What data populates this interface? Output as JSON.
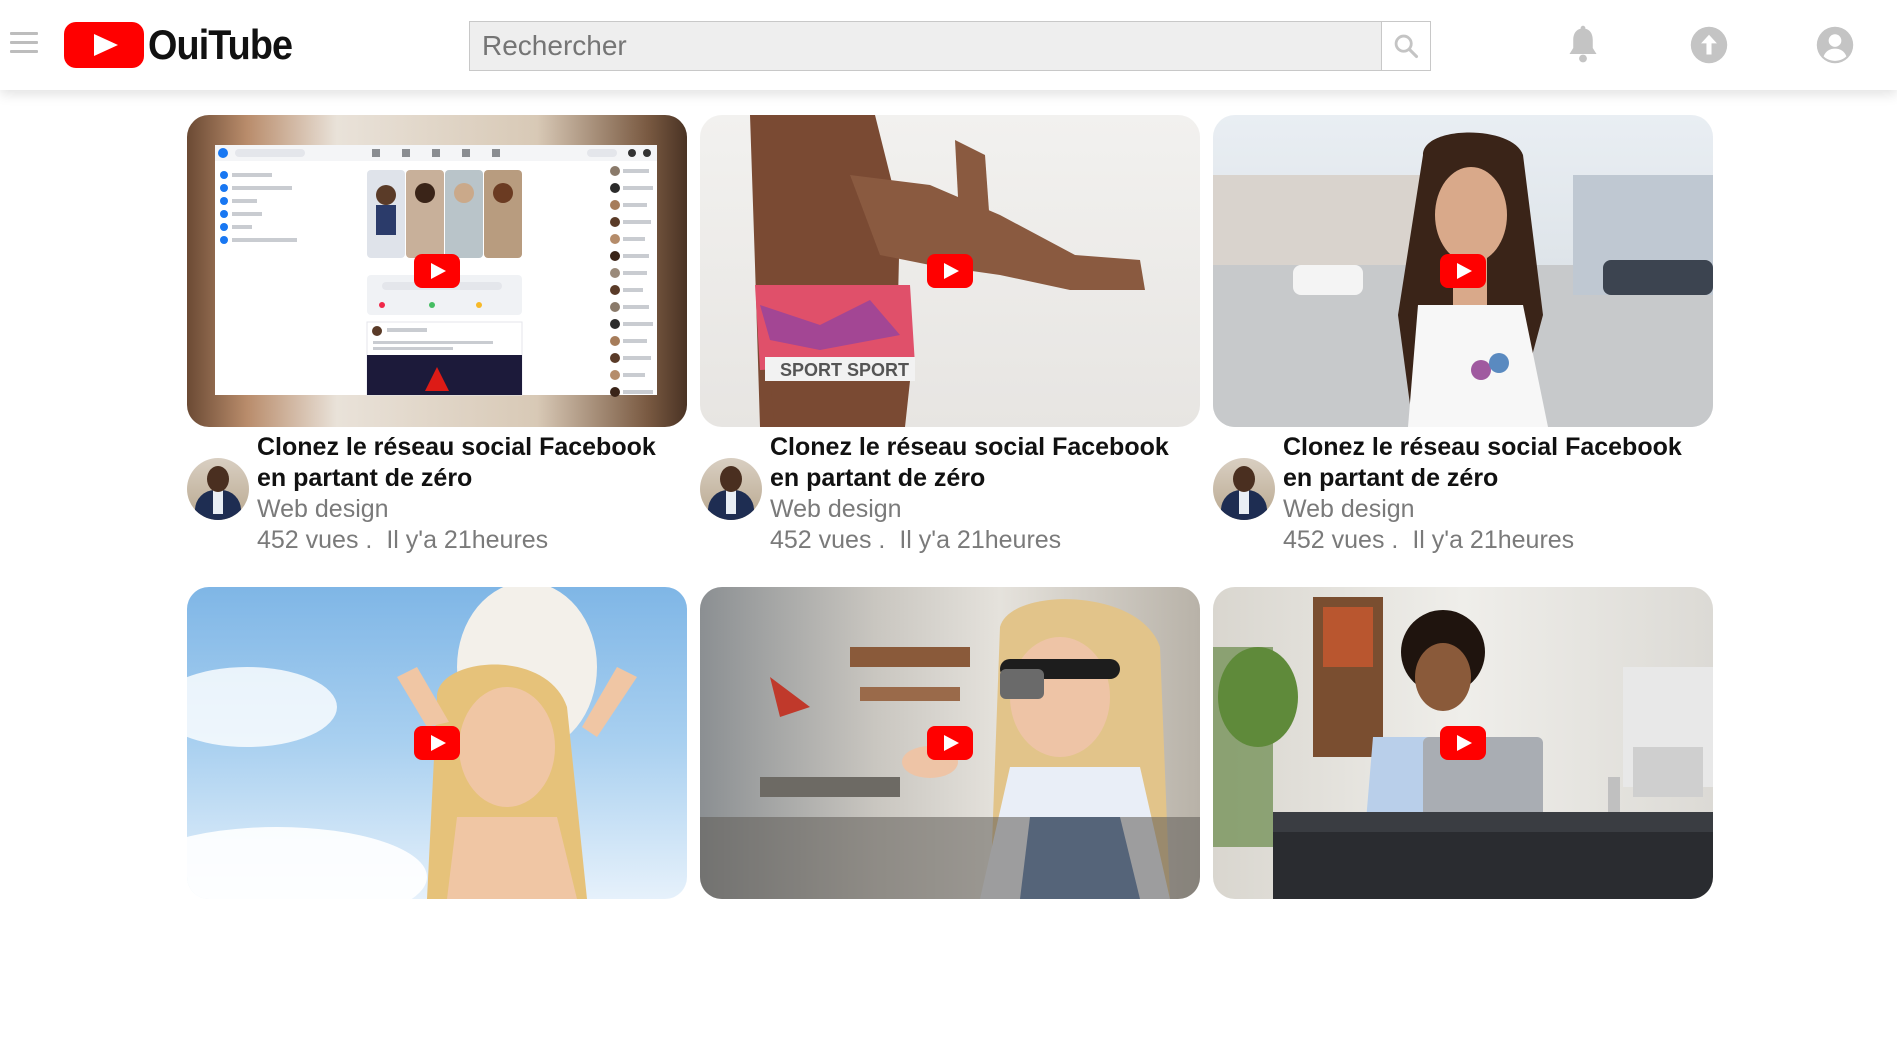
{
  "header": {
    "logo_text": "OuiTube",
    "search_placeholder": "Rechercher",
    "icons": [
      "menu-icon",
      "search-icon",
      "bell-icon",
      "upload-icon",
      "account-icon"
    ]
  },
  "colors": {
    "brand_red": "#ff0000",
    "icon_gray": "#c4c4c4",
    "meta_gray": "#7a7a7a"
  },
  "videos": [
    {
      "title": "Clonez le réseau social Facebook en partant de zéro",
      "channel": "Web design",
      "views": "452 vues .",
      "time": "Il y'a 21heures"
    },
    {
      "title": "Clonez le réseau social Facebook en partant de zéro",
      "channel": "Web design",
      "views": "452 vues .",
      "time": "Il y'a 21heures"
    },
    {
      "title": "Clonez le réseau social Facebook en partant de zéro",
      "channel": "Web design",
      "views": "452 vues .",
      "time": "Il y'a 21heures"
    },
    {
      "title": "",
      "channel": "",
      "views": "",
      "time": ""
    },
    {
      "title": "",
      "channel": "",
      "views": "",
      "time": ""
    },
    {
      "title": "",
      "channel": "",
      "views": "",
      "time": ""
    }
  ]
}
